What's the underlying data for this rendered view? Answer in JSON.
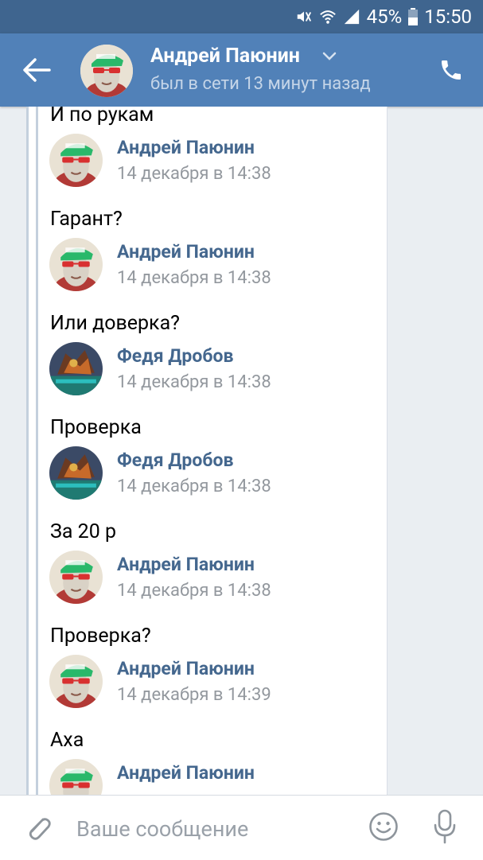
{
  "statusbar": {
    "battery": "45%",
    "time": "15:50"
  },
  "header": {
    "name": "Андрей Паюнин",
    "status": "был в сети 13 минут назад"
  },
  "messages": [
    {
      "type": "text",
      "text": "И по рукам"
    },
    {
      "type": "author",
      "name": "Андрей Паюнин",
      "date": "14 декабря в 14:38",
      "avatar": "andrey"
    },
    {
      "type": "text",
      "text": "Гарант?"
    },
    {
      "type": "author",
      "name": "Андрей Паюнин",
      "date": "14 декабря в 14:38",
      "avatar": "andrey"
    },
    {
      "type": "text",
      "text": "Или доверка?"
    },
    {
      "type": "author",
      "name": "Федя Дробов",
      "date": "14 декабря в 14:38",
      "avatar": "fedya"
    },
    {
      "type": "text",
      "text": "Проверка"
    },
    {
      "type": "author",
      "name": "Федя Дробов",
      "date": "14 декабря в 14:38",
      "avatar": "fedya"
    },
    {
      "type": "text",
      "text": "За 20 р"
    },
    {
      "type": "author",
      "name": "Андрей Паюнин",
      "date": "14 декабря в 14:38",
      "avatar": "andrey"
    },
    {
      "type": "text",
      "text": "Проверка?"
    },
    {
      "type": "author",
      "name": "Андрей Паюнин",
      "date": "14 декабря в 14:39",
      "avatar": "andrey"
    },
    {
      "type": "text",
      "text": "Аха"
    },
    {
      "type": "author",
      "name": "Андрей Паюнин",
      "date": "",
      "avatar": "andrey"
    }
  ],
  "composer": {
    "placeholder": "Ваше сообщение"
  },
  "colors": {
    "header_bg": "#5181b8",
    "statusbar_bg": "#3f658f",
    "author_name": "#44678e",
    "date_text": "#93989e"
  }
}
